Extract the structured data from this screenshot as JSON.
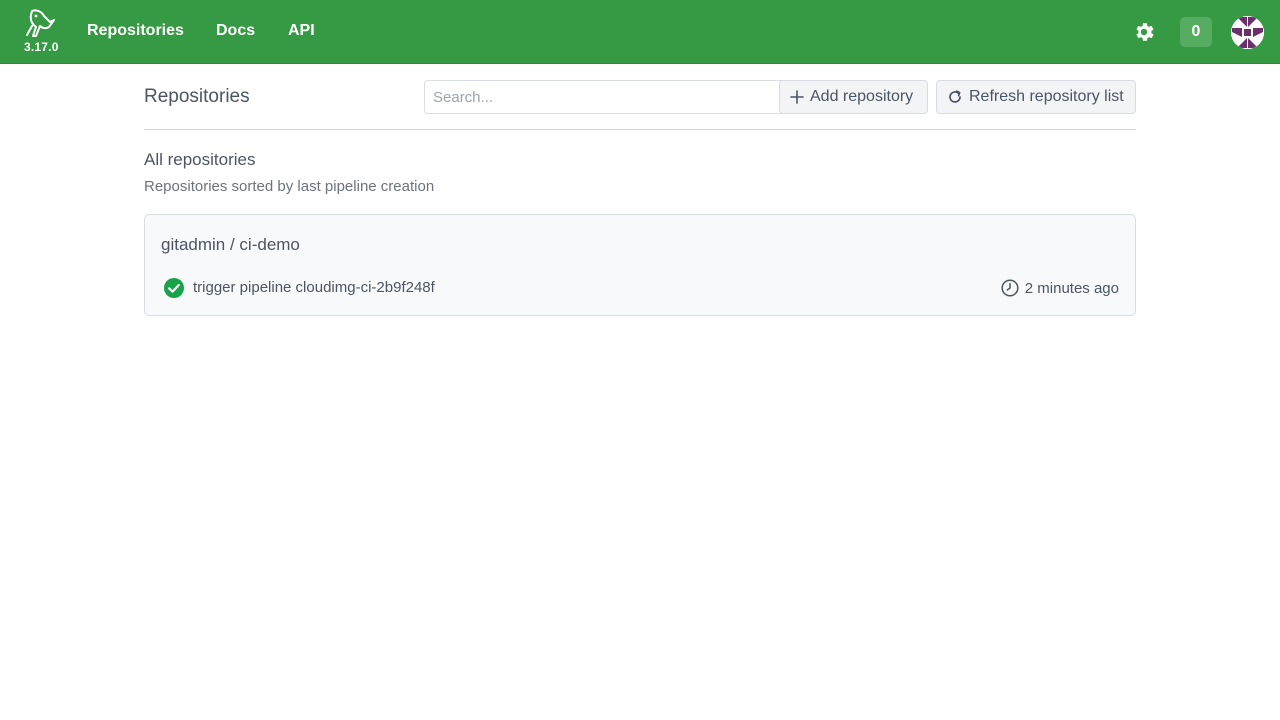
{
  "app": {
    "version": "3.17.0",
    "brand_color": "#369943"
  },
  "nav": {
    "links": [
      {
        "label": "Repositories"
      },
      {
        "label": "Docs"
      },
      {
        "label": "API"
      }
    ],
    "pipeline_count": "0",
    "settings_icon": "gear-icon",
    "avatar_icon": "user-avatar"
  },
  "page": {
    "title": "Repositories",
    "search_placeholder": "Search...",
    "add_button_label": "Add repository",
    "refresh_button_label": "Refresh repository list"
  },
  "section": {
    "title": "All repositories",
    "subtitle": "Repositories sorted by last pipeline creation"
  },
  "repositories": [
    {
      "name": "gitadmin / ci-demo",
      "status": "success",
      "status_color": "#16a34a",
      "pipeline_message": "trigger pipeline cloudimg-ci-2b9f248f",
      "time_ago": "2 minutes ago"
    }
  ]
}
